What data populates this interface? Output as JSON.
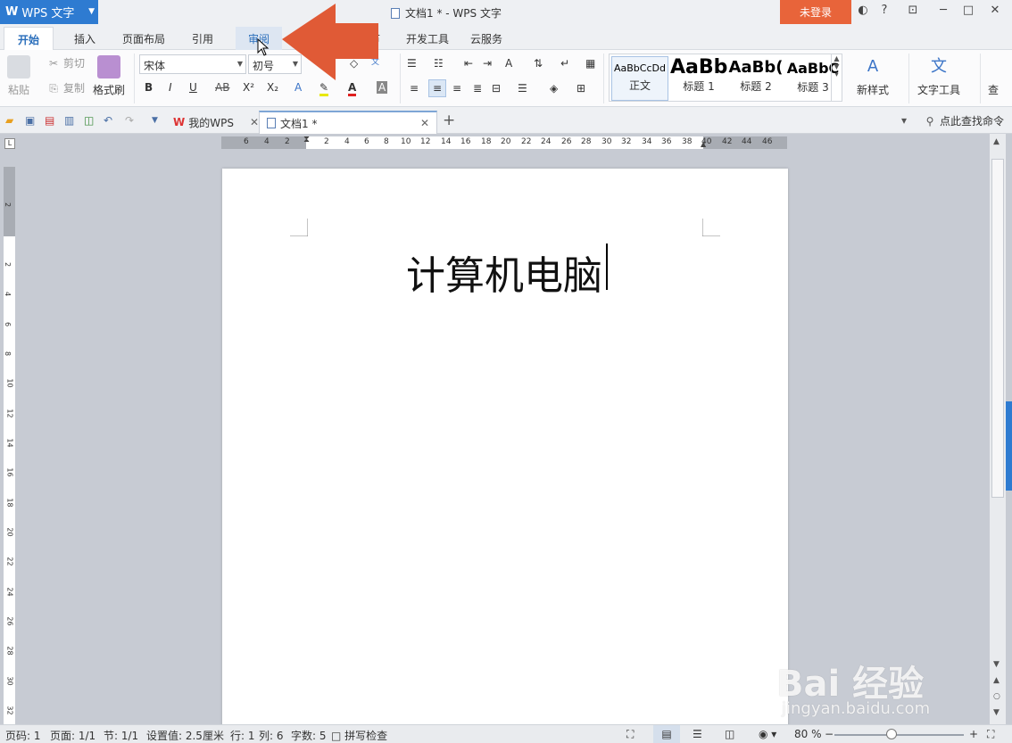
{
  "titlebar": {
    "app_name": "WPS 文字",
    "window_title": "文档1 * - WPS 文字",
    "login_label": "未登录",
    "help_label": "?"
  },
  "menu_tabs": [
    "开始",
    "插入",
    "页面布局",
    "引用",
    "审阅",
    "节",
    "开发工具",
    "云服务"
  ],
  "ribbon": {
    "paste": "粘贴",
    "cut": "剪切",
    "copy": "复制",
    "format_painter": "格式刷",
    "font_name": "宋体",
    "font_size": "初号",
    "bold": "B",
    "italic": "I",
    "underline": "U",
    "strike": "AB",
    "superscript": "X²",
    "subscript": "X₂",
    "styles": [
      {
        "sample": "AaBbCcDd",
        "label": "正文"
      },
      {
        "sample": "AaBb",
        "label": "标题 1"
      },
      {
        "sample": "AaBb(",
        "label": "标题 2"
      },
      {
        "sample": "AaBbC",
        "label": "标题 3"
      }
    ],
    "new_style": "新样式",
    "text_tools": "文字工具",
    "find": "查"
  },
  "doc_tabs": {
    "tab1": "我的WPS",
    "tab2": "文档1 *",
    "search_command": "点此查找命令"
  },
  "ruler": {
    "horizontal": [
      "6",
      "4",
      "2",
      "2",
      "4",
      "6",
      "8",
      "10",
      "12",
      "14",
      "16",
      "18",
      "20",
      "22",
      "24",
      "26",
      "28",
      "30",
      "32",
      "34",
      "36",
      "38",
      "40",
      "42",
      "44",
      "46"
    ],
    "vertical": [
      "2",
      "2",
      "4",
      "6",
      "8",
      "10",
      "12",
      "14",
      "16",
      "18",
      "20",
      "22",
      "24",
      "26",
      "28",
      "30",
      "32"
    ]
  },
  "document": {
    "text": "计算机电脑"
  },
  "statusbar": {
    "page": "页码: 1",
    "pages": "页面: 1/1",
    "section": "节: 1/1",
    "setting": "设置值: 2.5厘米",
    "row": "行: 1",
    "col": "列: 6",
    "words": "字数: 5",
    "spellcheck": "拼写检查",
    "zoom": "80 %"
  },
  "watermark": {
    "brand": "Bai 经验",
    "url": "jingyan.baidu.com"
  },
  "colors": {
    "accent_blue": "#2e7bd1",
    "login_orange": "#e8643a",
    "arrow_orange": "#e05a36"
  }
}
